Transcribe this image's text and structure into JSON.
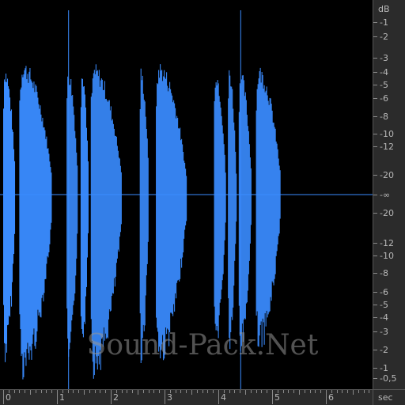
{
  "db_ruler": {
    "unit_label": "dB",
    "upper_labels": [
      "-1",
      "-2",
      "-3",
      "-4",
      "-5",
      "-6",
      "-8",
      "-10",
      "-12",
      "-20"
    ],
    "center_label": "-∞",
    "lower_labels": [
      "-20",
      "-12",
      "-10",
      "-8",
      "-6",
      "-5",
      "-4",
      "-3",
      "-2",
      "-1",
      "-0,5"
    ]
  },
  "time_ruler": {
    "unit_label": "sec",
    "labels": [
      "0",
      "1",
      "2",
      "3",
      "4",
      "5",
      "6"
    ]
  },
  "waveform": {
    "color": "#3a8cff",
    "clips": [
      {
        "start": 0.0,
        "end": 0.22
      },
      {
        "start": 0.3,
        "end": 0.9
      },
      {
        "start": 1.18,
        "end": 1.38
      },
      {
        "start": 1.44,
        "end": 1.58
      },
      {
        "start": 1.63,
        "end": 2.2
      },
      {
        "start": 2.54,
        "end": 2.7
      },
      {
        "start": 2.84,
        "end": 3.4
      },
      {
        "start": 3.92,
        "end": 4.13
      },
      {
        "start": 4.18,
        "end": 4.33
      },
      {
        "start": 4.38,
        "end": 4.61
      },
      {
        "start": 4.7,
        "end": 5.15
      }
    ]
  },
  "watermark": "Sound-Pack.Net"
}
